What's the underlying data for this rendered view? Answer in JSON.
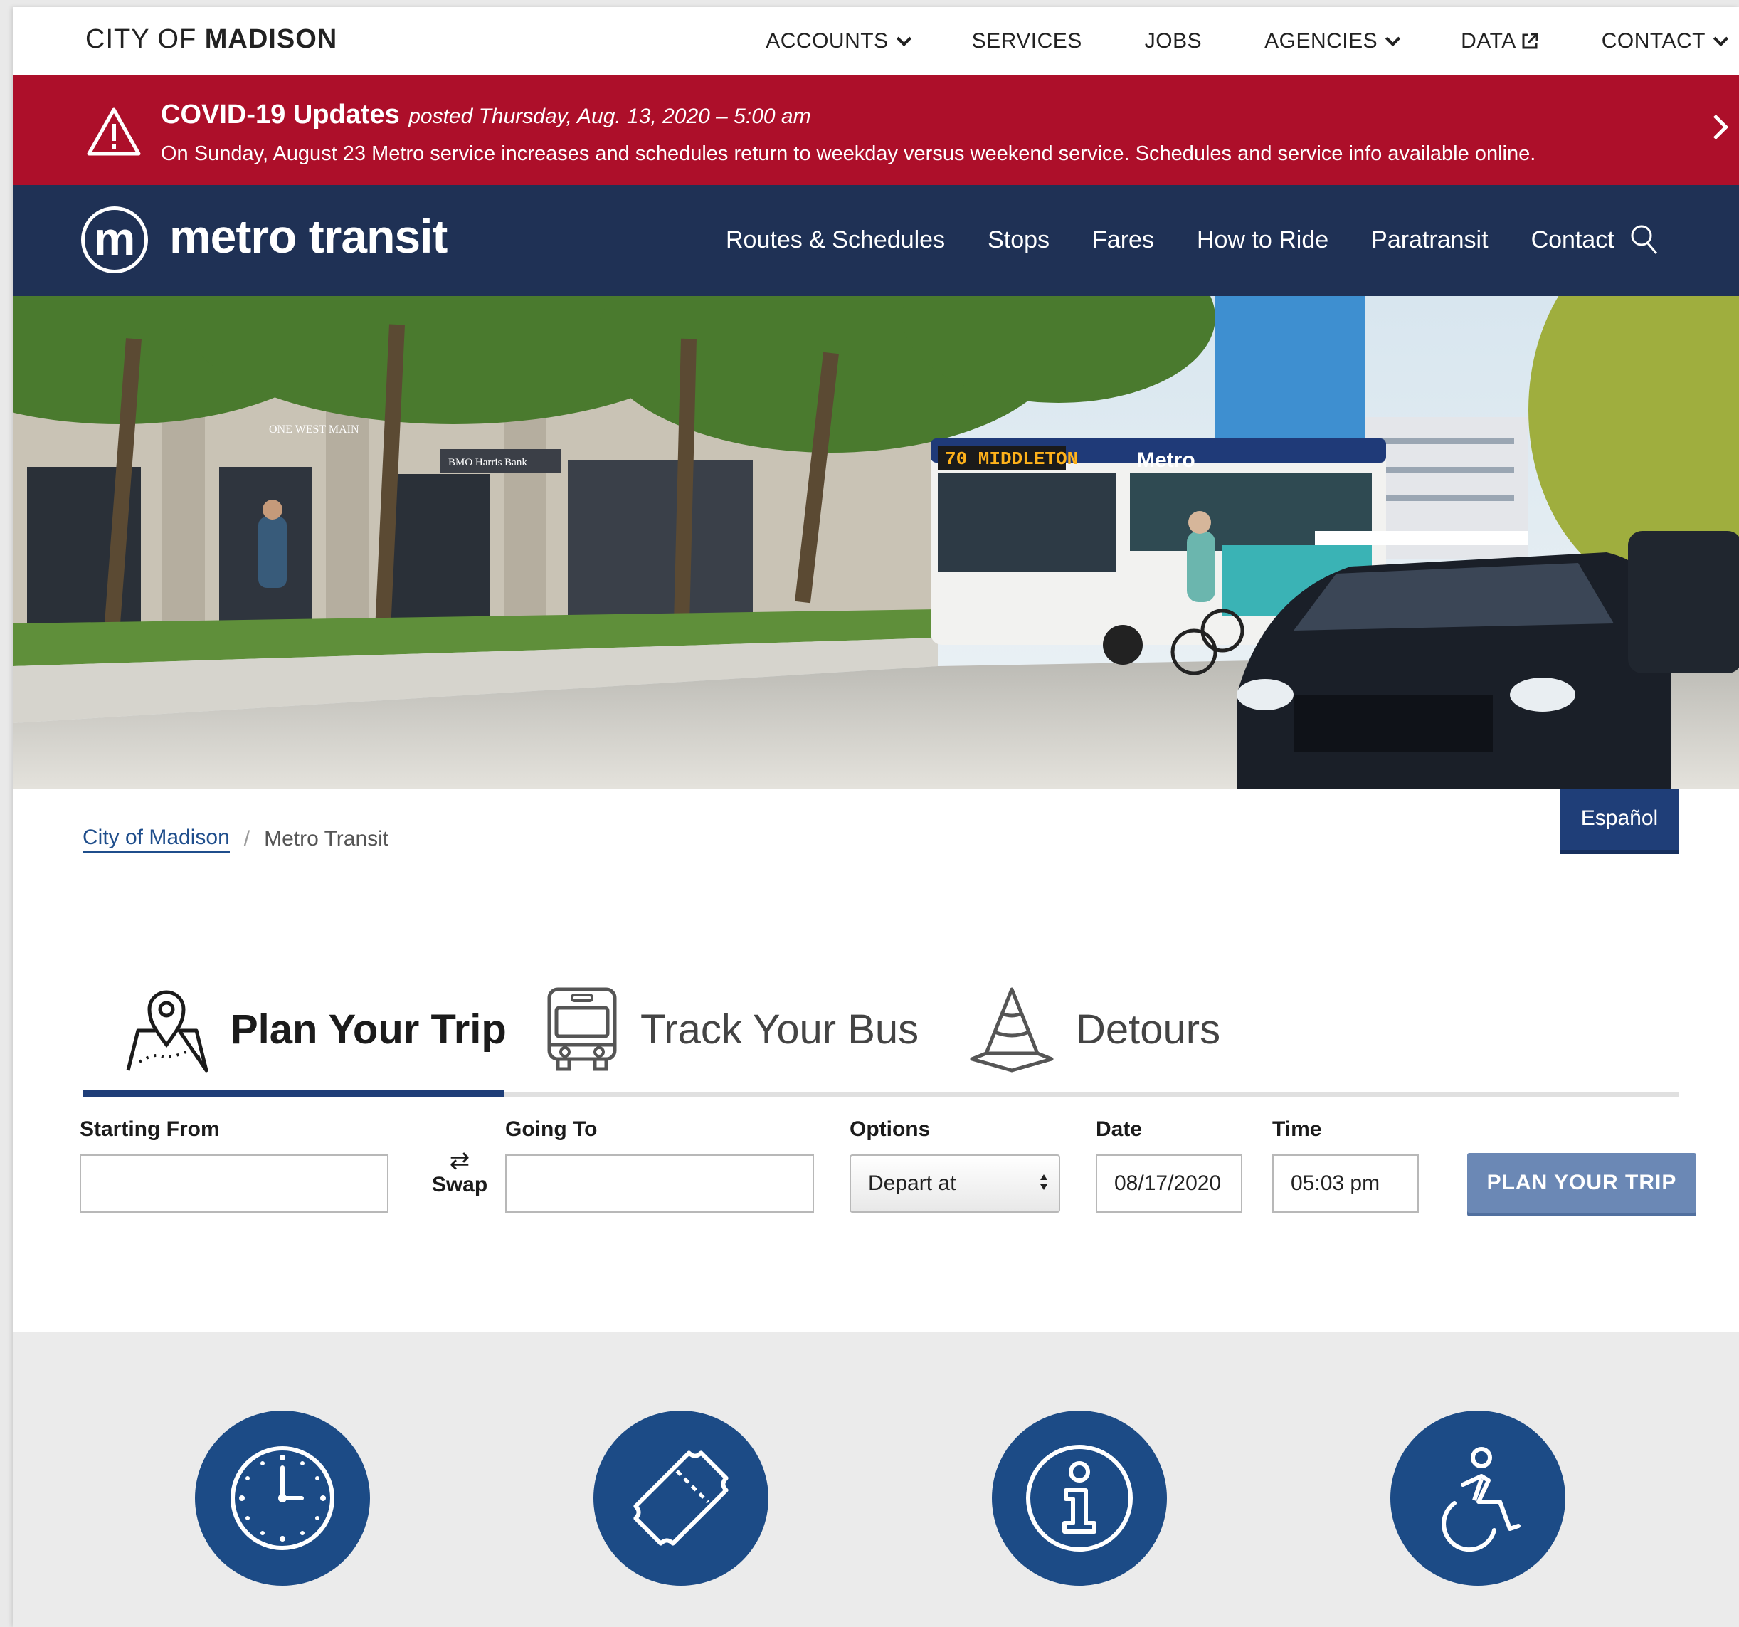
{
  "city_header": {
    "logo_prefix": "CITY OF",
    "logo_name": "MADISON",
    "nav": [
      {
        "label": "ACCOUNTS",
        "has_dropdown": true
      },
      {
        "label": "SERVICES",
        "has_dropdown": false
      },
      {
        "label": "JOBS",
        "has_dropdown": false
      },
      {
        "label": "AGENCIES",
        "has_dropdown": true
      },
      {
        "label": "DATA",
        "external": true
      },
      {
        "label": "CONTACT",
        "has_dropdown": true
      }
    ]
  },
  "alert": {
    "title": "COVID-19 Updates",
    "posted": "posted Thursday, Aug. 13, 2020 – 5:00 am",
    "body": "On Sunday, August 23 Metro service increases and schedules return to weekday versus weekend service. Schedules and service info available online.",
    "icon": "warning-triangle-icon",
    "color": "#ad0f2a"
  },
  "metro_header": {
    "logo_letter": "m",
    "logo_text": "metro transit",
    "nav": [
      "Routes & Schedules",
      "Stops",
      "Fares",
      "How to Ride",
      "Paratransit",
      "Contact"
    ],
    "color": "#1f3155"
  },
  "hero": {
    "bus_sign": "70 MIDDLETON",
    "bus_brand": "Metro",
    "building_sign": "ONE WEST MAIN",
    "bank_sign": "BMO Harris Bank"
  },
  "breadcrumb": {
    "home": "City of Madison",
    "current": "Metro Transit"
  },
  "language_button": "Español",
  "tabs": [
    {
      "label": "Plan Your Trip",
      "icon": "map-pin-icon",
      "active": true
    },
    {
      "label": "Track Your Bus",
      "icon": "bus-icon",
      "active": false
    },
    {
      "label": "Detours",
      "icon": "traffic-cone-icon",
      "active": false
    }
  ],
  "trip_form": {
    "starting_from_label": "Starting From",
    "starting_from_value": "",
    "swap_label": "Swap",
    "going_to_label": "Going To",
    "going_to_value": "",
    "options_label": "Options",
    "options_value": "Depart at",
    "date_label": "Date",
    "date_value": "08/17/2020",
    "time_label": "Time",
    "time_value": "05:03 pm",
    "submit_label": "PLAN YOUR TRIP"
  },
  "quick_links": [
    {
      "icon": "clock-icon"
    },
    {
      "icon": "ticket-icon"
    },
    {
      "icon": "info-icon"
    },
    {
      "icon": "accessibility-icon"
    }
  ],
  "colors": {
    "accent": "#1f3e78",
    "button": "#6b88b5",
    "circle": "#1c4b86"
  }
}
